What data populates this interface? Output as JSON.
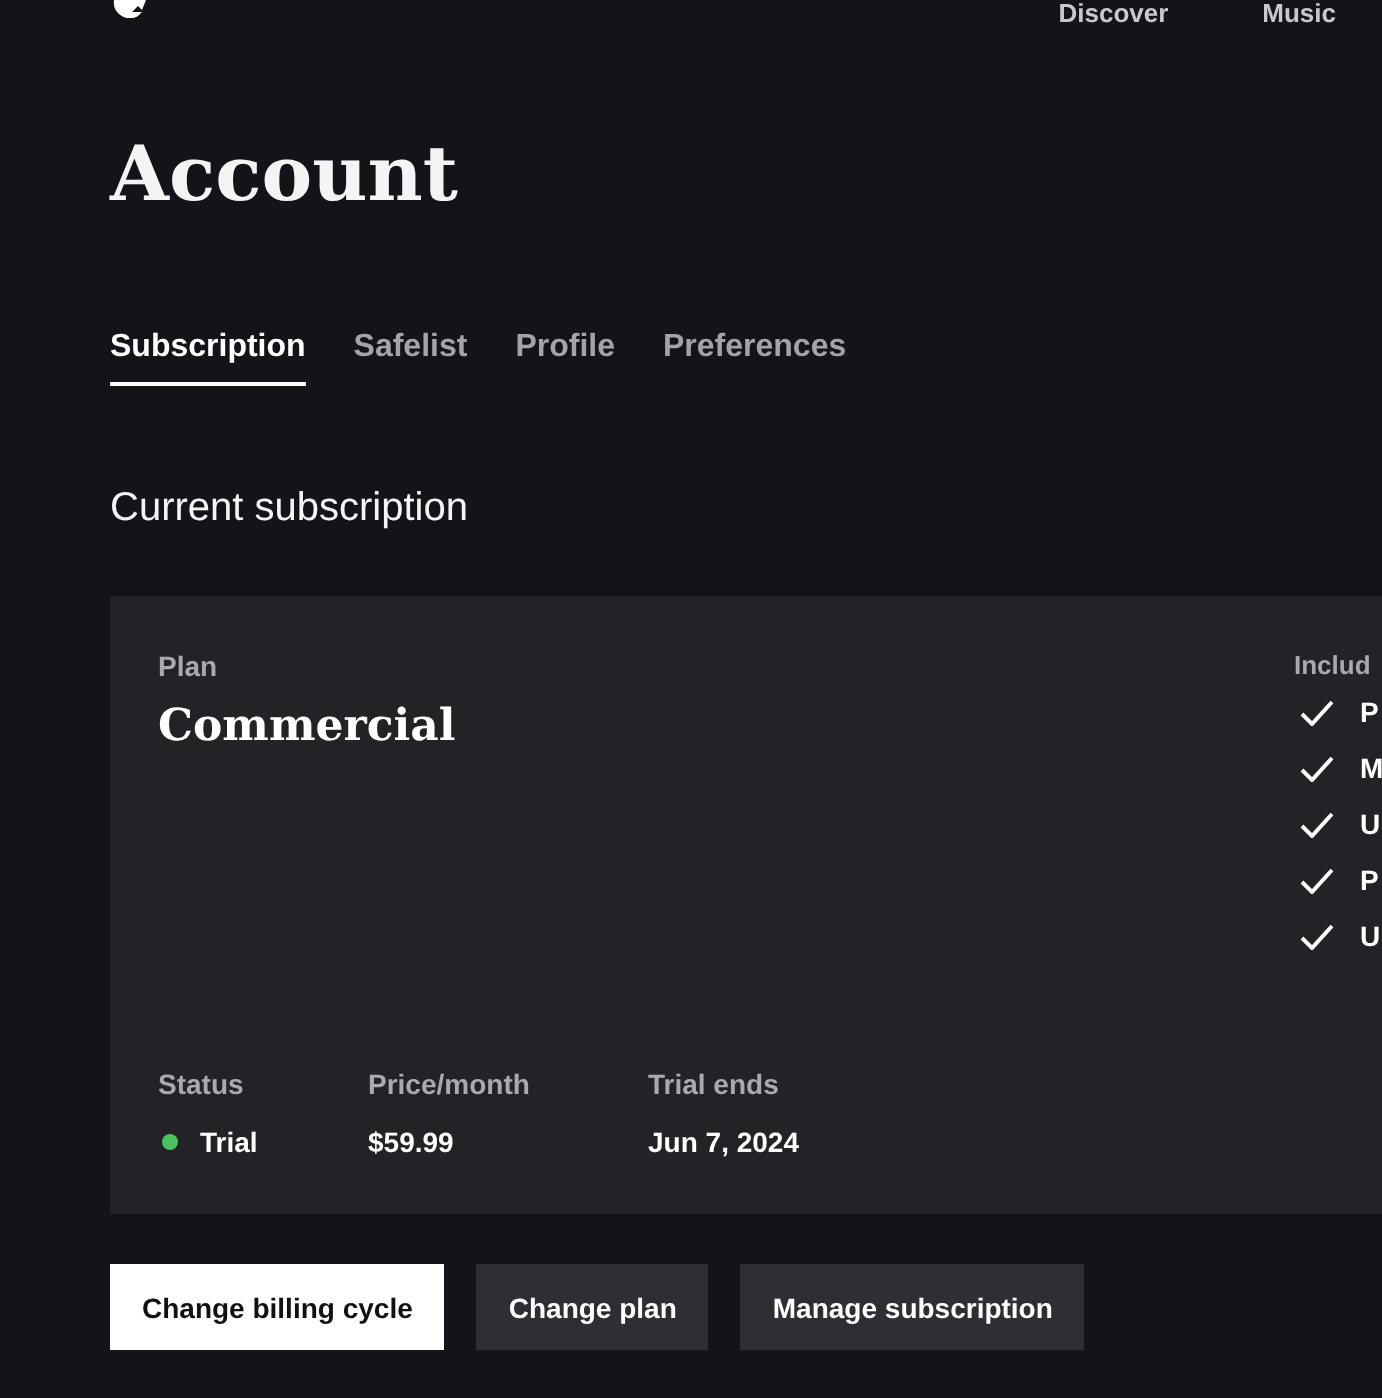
{
  "header": {
    "nav": [
      {
        "label": "Discover"
      },
      {
        "label": "Music"
      }
    ]
  },
  "page": {
    "title": "Account"
  },
  "tabs": [
    {
      "label": "Subscription",
      "selected": true
    },
    {
      "label": "Safelist",
      "selected": false
    },
    {
      "label": "Profile",
      "selected": false
    },
    {
      "label": "Preferences",
      "selected": false
    }
  ],
  "section": {
    "title": "Current subscription"
  },
  "plan_card": {
    "plan_label": "Plan",
    "plan_name": "Commercial",
    "includes_label": "Includ",
    "features": [
      "P",
      "M",
      "U",
      "P",
      "U"
    ],
    "details": [
      {
        "kind": "status",
        "label": "Status",
        "value": "Trial",
        "color": "#4cc15f"
      },
      {
        "kind": "text",
        "label": "Price/month",
        "value": "$59.99"
      },
      {
        "kind": "text",
        "label": "Trial ends",
        "value": "Jun 7, 2024"
      }
    ]
  },
  "buttons": [
    {
      "kind": "primary",
      "label": "Change billing cycle"
    },
    {
      "kind": "secondary",
      "label": "Change plan"
    },
    {
      "kind": "secondary",
      "label": "Manage subscription"
    }
  ]
}
